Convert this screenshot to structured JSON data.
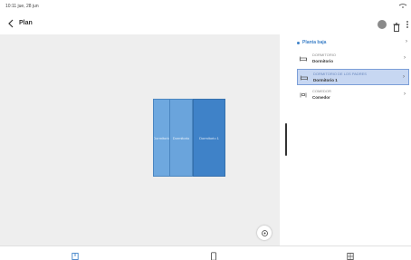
{
  "status_bar": {
    "time_date": "10:11  jue, 28 jun",
    "right": ""
  },
  "header": {
    "title": "Plan"
  },
  "canvas": {
    "rooms": [
      {
        "label": "Dormitorio"
      },
      {
        "label": "Dormitorio"
      },
      {
        "label": "Dormitorio 1"
      }
    ]
  },
  "panel": {
    "floor": {
      "label": "Planta baja"
    },
    "rooms": [
      {
        "type": "DORMITORIO",
        "name": "Dormitorio",
        "icon": "bed-icon"
      },
      {
        "type": "DORMITORIO DE LOS PADRES",
        "name": "Dormitorio 1",
        "icon": "bed-icon"
      },
      {
        "type": "COMEDOR",
        "name": "Comedor",
        "icon": "dining-icon"
      }
    ]
  },
  "colors": {
    "accent": "#3f82c8",
    "room_light": "#6ea8df",
    "room_dark": "#3f82c8",
    "selected_row": "#c7d7f2"
  }
}
